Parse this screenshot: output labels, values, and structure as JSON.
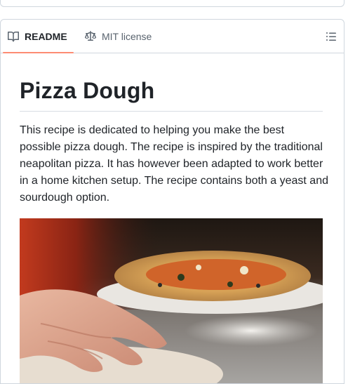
{
  "tabs": {
    "readme_label": "README",
    "readme_icon": "book-icon",
    "license_label": "MIT license",
    "license_icon": "law-scale-icon",
    "toc_icon": "list-unordered-icon",
    "active_underline_color": "#fd8c73"
  },
  "article": {
    "title": "Pizza Dough",
    "description": "This recipe is dedicated to helping you make the best possible pizza dough. The recipe is inspired by the traditional neapolitan pizza. It has however been adapted to work better in a home kitchen setup. The recipe contains both a yeast and sourdough option."
  },
  "colors": {
    "border": "#d0d7de",
    "text": "#1f2328",
    "muted": "#59636e"
  }
}
